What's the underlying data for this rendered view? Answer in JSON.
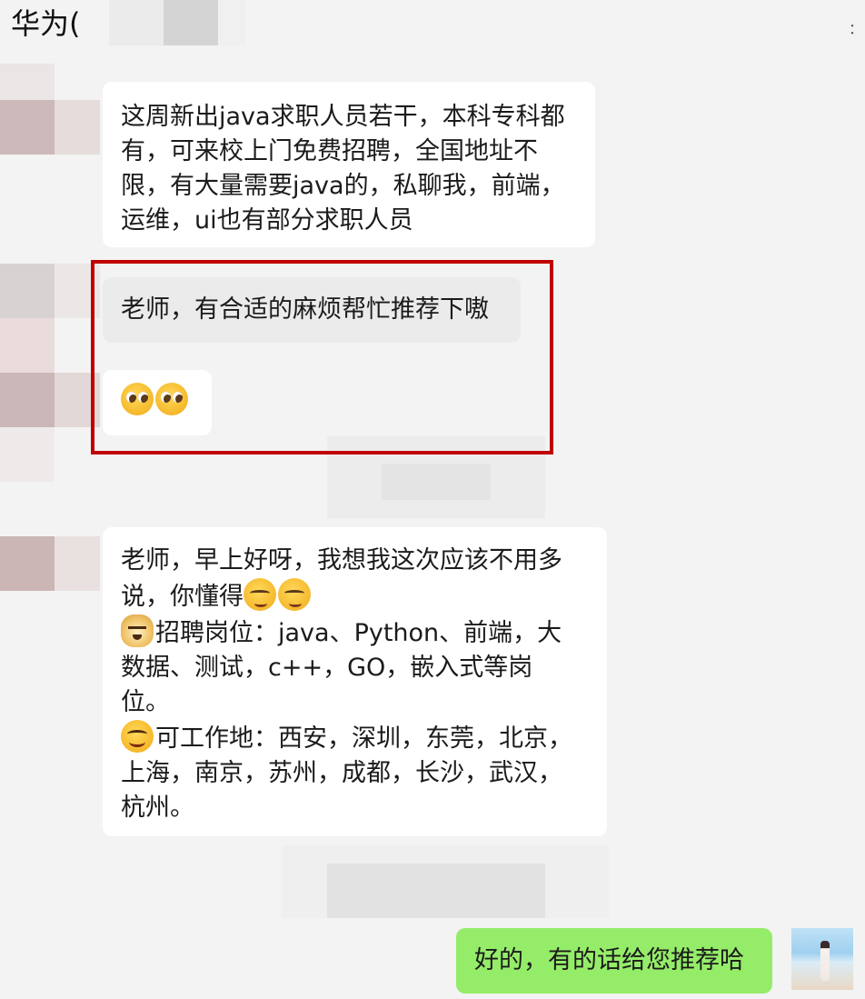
{
  "header": {
    "title": "华为(",
    "overflow_mark": "："
  },
  "messages": [
    {
      "sender": "other",
      "lines": [
        "这周新出java求职人员若干，本科专科都",
        "有，可来校上门免费招聘，全国地址不",
        "限，有大量需要java的，私聊我，前端，",
        "运维，ui也有部分求职人员"
      ]
    },
    {
      "sender": "me",
      "text": "老师，有合适的麻烦帮忙推荐下嗷"
    },
    {
      "sender": "me",
      "emojis": [
        "pleading-face-icon",
        "pleading-face-icon"
      ]
    },
    {
      "sender": "other",
      "line1": "老师，早上好呀，我想我这次应该不用多",
      "line2": "说，你懂得",
      "line3": "招聘岗位：java、Python、前端，大",
      "line4": "数据、测试，c++，GO，嵌入式等岗",
      "line5": "位。",
      "line6": "可工作地：西安，深圳，东莞，北京，",
      "line7": "上海，南京，苏州，成都，长沙，武汉，",
      "line8": "杭州。"
    },
    {
      "sender": "me",
      "text": "好的，有的话给您推荐哈"
    }
  ],
  "colors": {
    "background": "#f3f3f3",
    "bubble_other": "#ffffff",
    "bubble_grey": "#ebebeb",
    "bubble_self": "#95ec69",
    "highlight_border": "#c00000"
  }
}
